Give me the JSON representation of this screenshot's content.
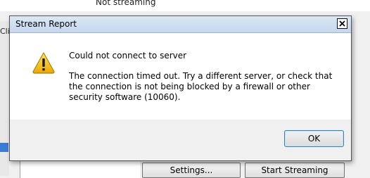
{
  "background": {
    "top_fragment_text": "Not streaming",
    "left_fragment_text": "Cli",
    "settings_button": "Settings...",
    "start_streaming_button": "Start Streaming"
  },
  "dialog": {
    "title": "Stream Report",
    "close_glyph": "X",
    "heading": "Could not connect to server",
    "message": "The connection timed out. Try a different server, or check that the connection is not being blocked by a firewall or other security software (10060).",
    "ok_label": "OK",
    "icon": "warning-icon"
  },
  "colors": {
    "titlebar": "#c6d8ee",
    "ok_border": "#3c7fb1",
    "warning_yellow": "#f5c518"
  }
}
